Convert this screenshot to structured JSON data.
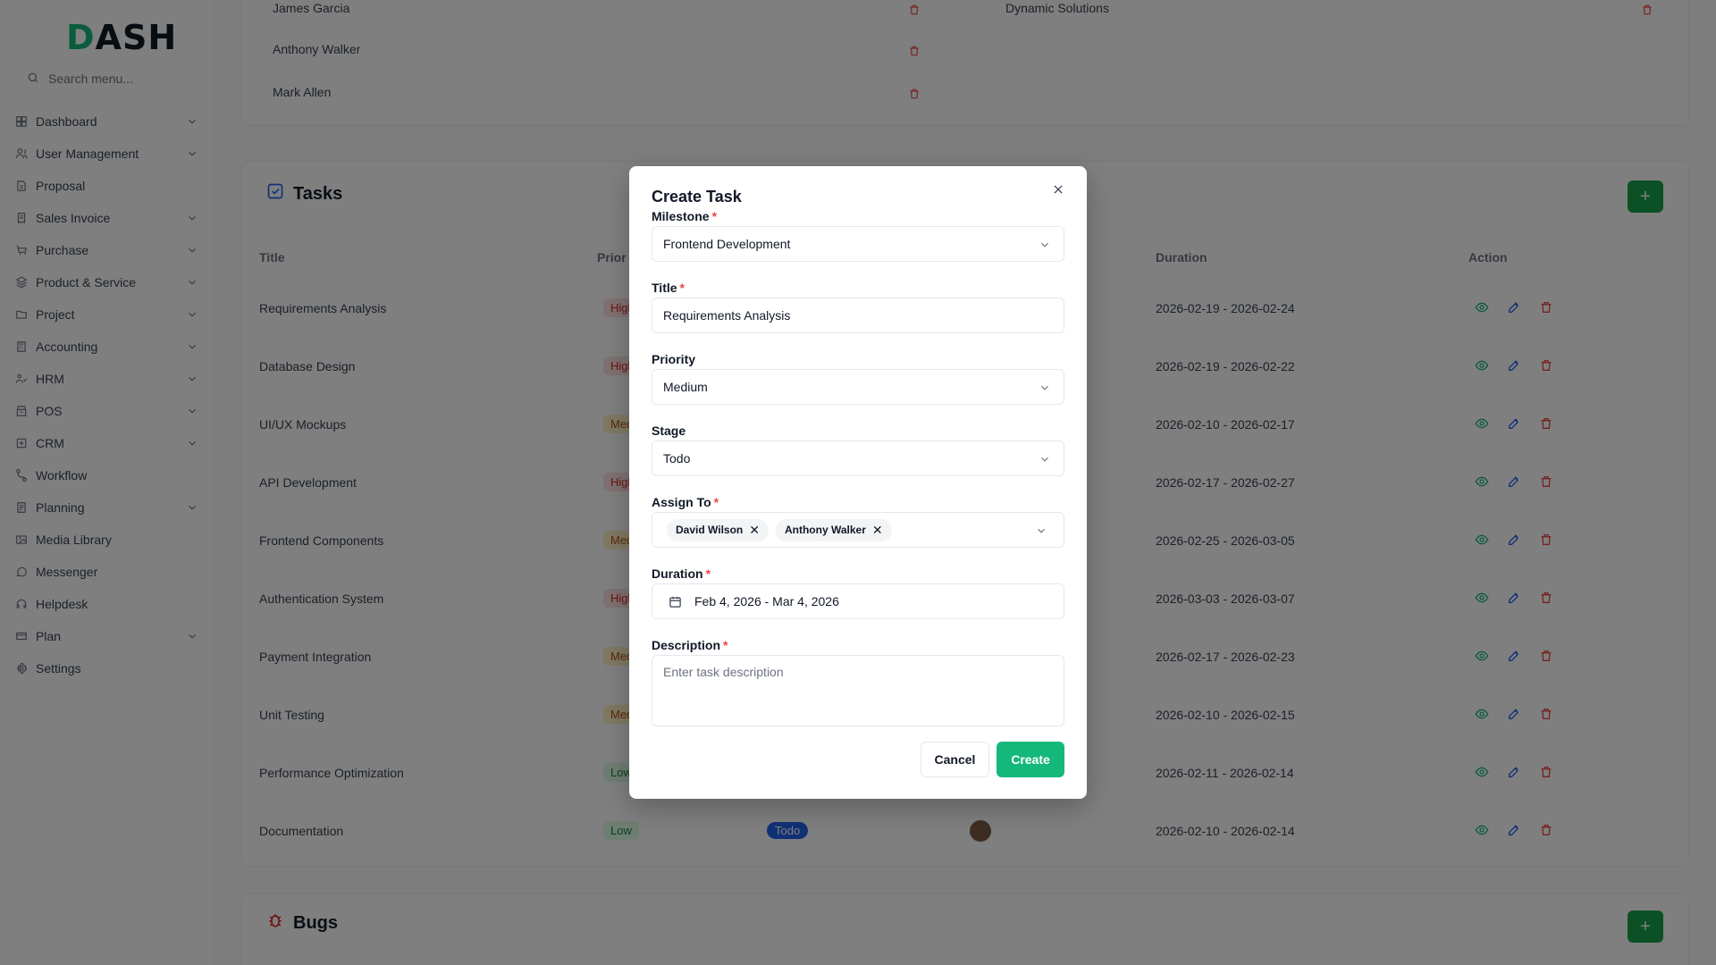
{
  "logo": {
    "text_main": "D",
    "text_rest": "ASH"
  },
  "search": {
    "placeholder": "Search menu..."
  },
  "sidebar": {
    "items": [
      {
        "label": "Dashboard",
        "has_chevron": true
      },
      {
        "label": "User Management",
        "has_chevron": true
      },
      {
        "label": "Proposal",
        "has_chevron": false
      },
      {
        "label": "Sales Invoice",
        "has_chevron": true
      },
      {
        "label": "Purchase",
        "has_chevron": true
      },
      {
        "label": "Product & Service",
        "has_chevron": true
      },
      {
        "label": "Project",
        "has_chevron": true
      },
      {
        "label": "Accounting",
        "has_chevron": true
      },
      {
        "label": "HRM",
        "has_chevron": true
      },
      {
        "label": "POS",
        "has_chevron": true
      },
      {
        "label": "CRM",
        "has_chevron": true
      },
      {
        "label": "Workflow",
        "has_chevron": false
      },
      {
        "label": "Planning",
        "has_chevron": true
      },
      {
        "label": "Media Library",
        "has_chevron": false
      },
      {
        "label": "Messenger",
        "has_chevron": false
      },
      {
        "label": "Helpdesk",
        "has_chevron": false
      },
      {
        "label": "Plan",
        "has_chevron": true
      },
      {
        "label": "Settings",
        "has_chevron": false
      }
    ]
  },
  "members": [
    "James Garcia",
    "Anthony Walker",
    "Mark Allen"
  ],
  "clients": [
    "Dynamic Solutions"
  ],
  "tasks": {
    "title": "Tasks",
    "columns": [
      "Title",
      "Prior",
      "Duration",
      "Action"
    ],
    "rows": [
      {
        "title": "Requirements Analysis",
        "priority": "High",
        "level": "high",
        "duration": "2026-02-19 - 2026-02-24"
      },
      {
        "title": "Database Design",
        "priority": "High",
        "level": "high",
        "duration": "2026-02-19 - 2026-02-22"
      },
      {
        "title": "UI/UX Mockups",
        "priority": "Med",
        "level": "med",
        "duration": "2026-02-10 - 2026-02-17"
      },
      {
        "title": "API Development",
        "priority": "High",
        "level": "high",
        "duration": "2026-02-17 - 2026-02-27"
      },
      {
        "title": "Frontend Components",
        "priority": "Med",
        "level": "med",
        "duration": "2026-02-25 - 2026-03-05"
      },
      {
        "title": "Authentication System",
        "priority": "High",
        "level": "high",
        "duration": "2026-03-03 - 2026-03-07"
      },
      {
        "title": "Payment Integration",
        "priority": "Med",
        "level": "med",
        "duration": "2026-02-17 - 2026-02-23"
      },
      {
        "title": "Unit Testing",
        "priority": "Med",
        "level": "med",
        "duration": "2026-02-10 - 2026-02-15"
      },
      {
        "title": "Performance Optimization",
        "priority": "Low",
        "level": "low",
        "duration": "2026-02-11 - 2026-02-14"
      },
      {
        "title": "Documentation",
        "priority": "Low",
        "level": "low",
        "stage": "Todo",
        "duration": "2026-02-10 - 2026-02-14"
      }
    ]
  },
  "bugs": {
    "title": "Bugs"
  },
  "modal": {
    "title": "Create Task",
    "milestone_label": "Milestone",
    "milestone_value": "Frontend Development",
    "title_label": "Title",
    "title_value": "Requirements Analysis",
    "priority_label": "Priority",
    "priority_value": "Medium",
    "stage_label": "Stage",
    "stage_value": "Todo",
    "assign_label": "Assign To",
    "assignees": [
      "David Wilson",
      "Anthony Walker"
    ],
    "duration_label": "Duration",
    "duration_value": "Feb 4, 2026 - Mar 4, 2026",
    "description_label": "Description",
    "description_placeholder": "Enter task description",
    "cancel_label": "Cancel",
    "create_label": "Create",
    "required_mark": "*"
  },
  "colors": {
    "accent": "#14b87a",
    "danger": "#ef4444",
    "overlay": "rgba(0,0,0,0.5)"
  }
}
